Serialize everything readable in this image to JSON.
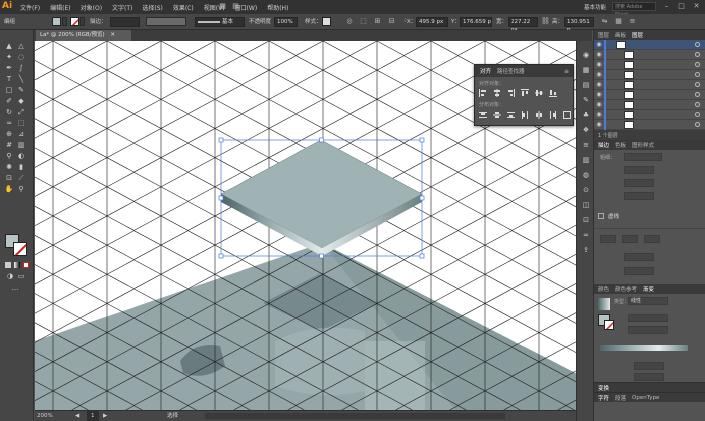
{
  "app": {
    "logo": "Ai",
    "menus": [
      "文件(F)",
      "编辑(E)",
      "对象(O)",
      "文字(T)",
      "选择(S)",
      "效果(C)",
      "视图(V)",
      "窗口(W)",
      "帮助(H)"
    ],
    "workspace": "基本功能",
    "search_placeholder": "搜索 Adobe Stock"
  },
  "controlbar": {
    "selection_label": "编组",
    "stroke_label": "描边：",
    "stroke_style": "基本",
    "opacity_label": "不透明度",
    "opacity_value": "100%",
    "style_label": "样式：",
    "x_value": "495.9 px",
    "y_value": "176.659 p",
    "w_value": "227.22 px",
    "h_value": "130.951 p",
    "fill_color": "#b7c4c6"
  },
  "document": {
    "tab_label": "La* @ 200% (RGB/预览)",
    "zoom": "200%",
    "page_nav": "1",
    "status_text": "选择"
  },
  "align_panel": {
    "tabs": [
      "对齐",
      "路径查找器"
    ],
    "align_objects_label": "对齐对象：",
    "distribute_objects_label": "分布对象："
  },
  "layers_panel": {
    "tabs": [
      "图层",
      "画板",
      "图层"
    ],
    "layer_name": "图层 1",
    "footer": "1 个图层"
  },
  "transform_panel": {
    "tabs": [
      "描边",
      "色板",
      "图形样式"
    ],
    "weight_label": "粗细："
  },
  "appearance_panel": {
    "title": "虚线"
  },
  "gradient_panel": {
    "tabs": [
      "颜色",
      "颜色参考",
      "渐变"
    ],
    "type_label": "类型：",
    "type_value": "线性"
  },
  "bottom_panels": {
    "transform": "变换",
    "character_tabs": [
      "字符",
      "段落",
      "OpenType"
    ]
  }
}
